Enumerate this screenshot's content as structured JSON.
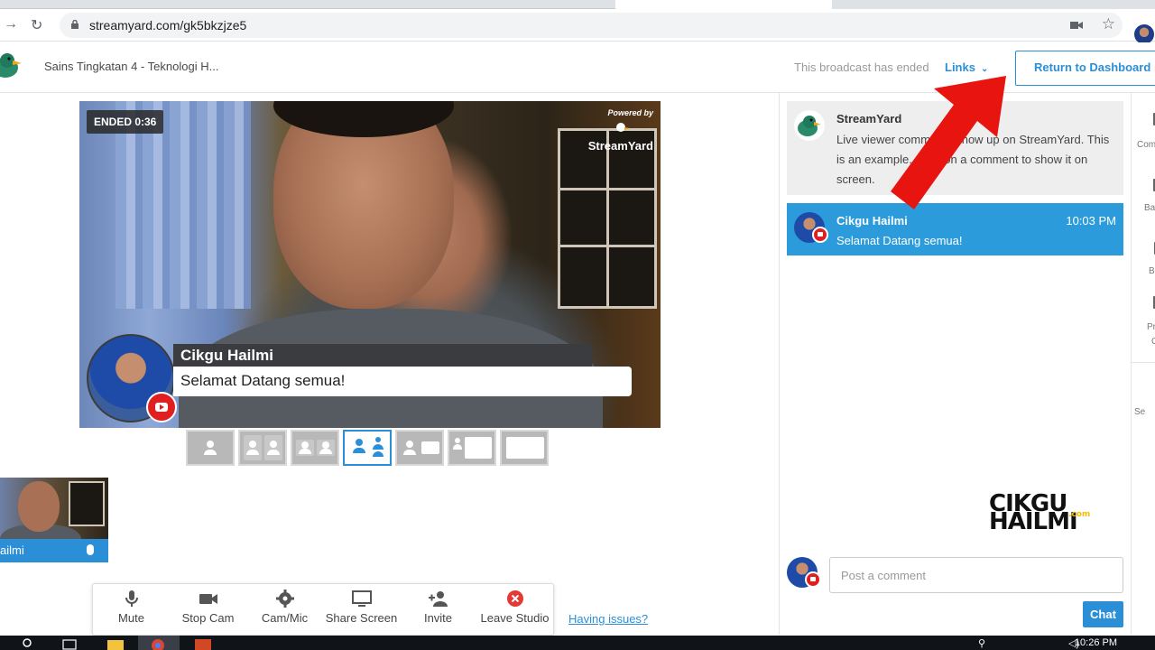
{
  "browser": {
    "url": "streamyard.com/gk5bkzjze5"
  },
  "header": {
    "broadcast_title": "Sains Tingkatan 4 - Teknologi H...",
    "status_text": "This broadcast has ended",
    "links_label": "Links",
    "return_button": "Return to Dashboard"
  },
  "stage": {
    "ended_badge": "ENDED 0:36",
    "powered_by": "Powered by",
    "powered_brand": "StreamYard",
    "banner_name": "Cikgu Hailmi",
    "banner_text": "Selamat Datang semua!"
  },
  "self_cam": {
    "name": "ailmi"
  },
  "controls": [
    {
      "label": "Mute",
      "icon": "mic-icon"
    },
    {
      "label": "Stop Cam",
      "icon": "camera-icon"
    },
    {
      "label": "Cam/Mic",
      "icon": "gear-icon"
    },
    {
      "label": "Share Screen",
      "icon": "monitor-icon"
    },
    {
      "label": "Invite",
      "icon": "add-person-icon"
    },
    {
      "label": "Leave Studio",
      "icon": "close-circle-icon"
    }
  ],
  "having_issues": "Having issues?",
  "comments": [
    {
      "author": "StreamYard",
      "text": "Live viewer comments show up on StreamYard. This is an example. Click on a comment to show it on screen.",
      "time": ""
    },
    {
      "author": "Cikgu Hailmi",
      "text": "Selamat Datang semua!",
      "time": "10:03 PM"
    }
  ],
  "watermark": {
    "line1": "CIKGU",
    "line2": "HAILMI",
    "suffix": ".com"
  },
  "post": {
    "placeholder": "Post a comment",
    "button": "Chat"
  },
  "rail": [
    "Com",
    "Ba",
    "B",
    "Pr",
    "C",
    "Se"
  ],
  "taskbar": {
    "time": "10:26 PM"
  },
  "colors": {
    "accent": "#2b8fd8",
    "highlight_comment": "#2b9bdc",
    "annotation_arrow": "#e8140f",
    "leave": "#e53935"
  }
}
